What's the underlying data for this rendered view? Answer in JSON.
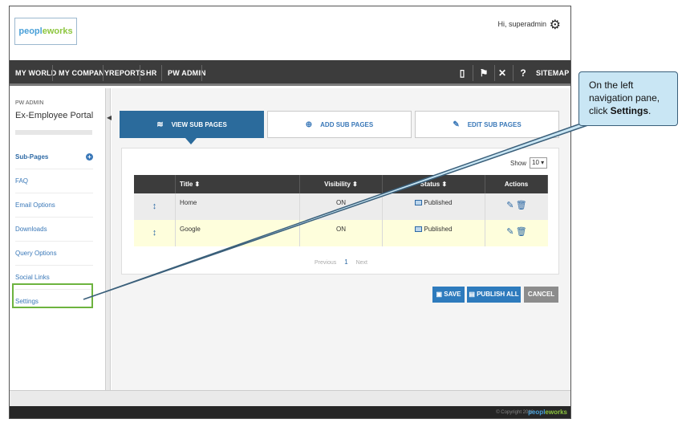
{
  "header": {
    "logo_part1": "peopl",
    "logo_part2": "eworks",
    "greeting": "Hi, superadmin"
  },
  "nav": {
    "items": [
      "MY WORLD",
      "MY COMPANY",
      "REPORTS",
      "HR",
      "PW ADMIN"
    ],
    "sitemap": "SITEMAP"
  },
  "sidebar": {
    "section": "PW ADMIN",
    "title": "Ex-Employee Portal",
    "items": [
      "Sub-Pages",
      "FAQ",
      "Email Options",
      "Downloads",
      "Query Options",
      "Social Links",
      "Settings"
    ]
  },
  "tabs": {
    "view": "VIEW SUB PAGES",
    "add": "ADD SUB PAGES",
    "edit": "EDIT SUB PAGES"
  },
  "table": {
    "show_label": "Show",
    "show_value": "10",
    "headers": [
      "Title",
      "Visibility",
      "Status",
      "Actions"
    ],
    "rows": [
      {
        "title": "Home",
        "visibility": "ON",
        "status": "Published"
      },
      {
        "title": "Google",
        "visibility": "ON",
        "status": "Published"
      }
    ],
    "pager": {
      "prev": "Previous",
      "page": "1",
      "next": "Next"
    }
  },
  "buttons": {
    "save": "SAVE",
    "publish": "PUBLISH ALL",
    "cancel": "CANCEL"
  },
  "footer": {
    "copyright": "© Copyright 2016",
    "logo_part1": "peopl",
    "logo_part2": "eworks"
  },
  "callout": {
    "line1": "On the left navigation pane, click ",
    "strong": "Settings",
    "line2": "."
  },
  "colors": {
    "accent": "#2b6b9c",
    "highlight_border": "#6db33f",
    "callout_fill": "#c9e6f4"
  }
}
